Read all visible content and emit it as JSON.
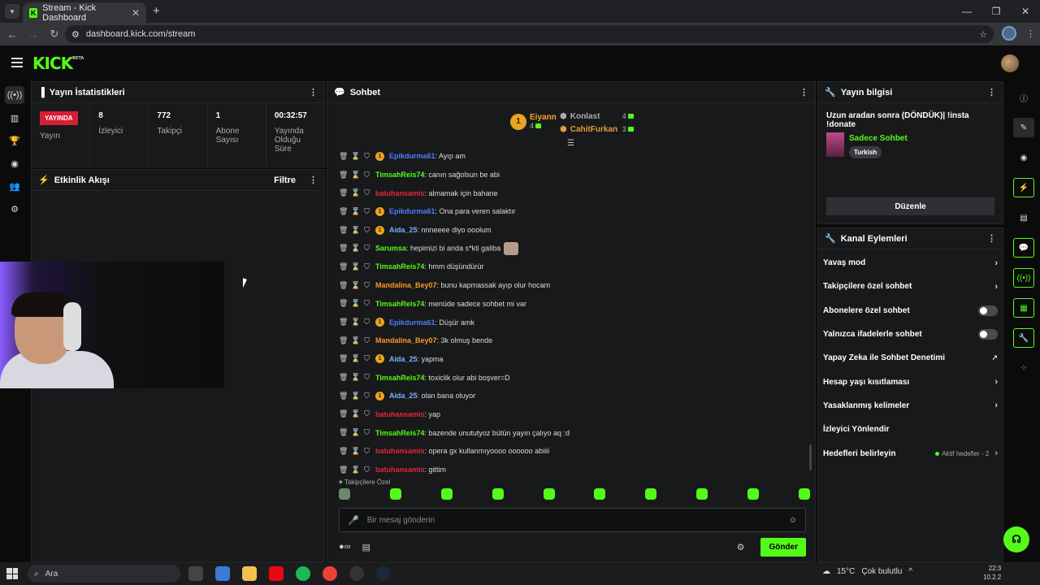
{
  "browser": {
    "tab_title": "Stream - Kick Dashboard",
    "url": "dashboard.kick.com/stream",
    "favicon_letter": "K"
  },
  "kick": {
    "logo": "KICK",
    "beta": "BETA"
  },
  "stats_panel": {
    "title": "Yayın İstatistikleri",
    "live_badge": "YAYINDA",
    "live_label": "Yayın",
    "viewers": {
      "value": "8",
      "label": "İzleyici"
    },
    "followers": {
      "value": "772",
      "label": "Takipçi"
    },
    "subs": {
      "value": "1",
      "label": "Abone Sayısı"
    },
    "uptime": {
      "value": "00:32:57",
      "label": "Yayında Olduğu Süre"
    }
  },
  "activity_panel": {
    "title": "Etkinlik Akışı",
    "filter": "Filtre"
  },
  "chat": {
    "title": "Sohbet",
    "leaderboard": {
      "first": {
        "rank": "1",
        "name": "Eiyann",
        "count": "4"
      },
      "others": [
        {
          "name": "Konlast",
          "count": "4",
          "color": "#aaaaaa"
        },
        {
          "name": "CahitFurkan",
          "count": "3",
          "color": "#e39a3b"
        }
      ]
    },
    "messages": [
      {
        "user": "Epikdurma61",
        "color": "#4a7dff",
        "badge": true,
        "text": ": Ayıp am"
      },
      {
        "user": "TimsahReis74",
        "color": "#53fc18",
        "badge": false,
        "text": ": canın sağolsun be abi"
      },
      {
        "user": "batuhansamis",
        "color": "#e0283c",
        "badge": false,
        "text": ": almamak için bahane"
      },
      {
        "user": "Epikdurma61",
        "color": "#4a7dff",
        "badge": true,
        "text": ": Ona para veren salaktır"
      },
      {
        "user": "Aida_25",
        "color": "#7ab0ff",
        "badge": true,
        "text": ": nnneeee diyo ooolum"
      },
      {
        "user": "Sarumsa",
        "color": "#53fc18",
        "badge": false,
        "text": ": hepimizi bi anda s*kti galiba",
        "emote": true
      },
      {
        "user": "TimsahReis74",
        "color": "#53fc18",
        "badge": false,
        "text": ": hmm düşündürür"
      },
      {
        "user": "Mandalina_Bey07",
        "color": "#f59a23",
        "badge": false,
        "text": ": bunu kapmassak ayıp olur hocam"
      },
      {
        "user": "TimsahReis74",
        "color": "#53fc18",
        "badge": false,
        "text": ": menüde sadece sohbet mi var"
      },
      {
        "user": "Epikdurma61",
        "color": "#4a7dff",
        "badge": true,
        "text": ": Düşür amk"
      },
      {
        "user": "Mandalina_Bey07",
        "color": "#f59a23",
        "badge": false,
        "text": ": 3k olmuş bende"
      },
      {
        "user": "Aida_25",
        "color": "#7ab0ff",
        "badge": true,
        "text": ": yapma"
      },
      {
        "user": "TimsahReis74",
        "color": "#53fc18",
        "badge": false,
        "text": ": toxiclik olur abi boşver=D"
      },
      {
        "user": "Aida_25",
        "color": "#7ab0ff",
        "badge": true,
        "text": ": olan bana oluyor"
      },
      {
        "user": "batuhansamis",
        "color": "#e0283c",
        "badge": false,
        "text": ": yap"
      },
      {
        "user": "TimsahReis74",
        "color": "#53fc18",
        "badge": false,
        "text": ": bazende unututyoz bütün yayın çalıyo aq :d"
      },
      {
        "user": "batuhansamis",
        "color": "#e0283c",
        "badge": false,
        "text": ": opera gx kullanmıyoooo oooooo abiiii"
      },
      {
        "user": "batuhansamis",
        "color": "#e0283c",
        "badge": false,
        "text": ": gittim"
      }
    ],
    "followers_only": "Takipçilere Özel",
    "input_placeholder": "Bir mesaj gönderin",
    "send": "Gönder",
    "badge_symbol": "1"
  },
  "stream_info": {
    "title": "Yayın bilgisi",
    "stream_title": "Uzun aradan sonra (DÖNDÜK)| !insta !donate",
    "category": "Sadece Sohbet",
    "tag": "Turkish",
    "edit": "Düzenle"
  },
  "channel_actions": {
    "title": "Kanal Eylemleri",
    "items": [
      {
        "label": "Yavaş mod",
        "kind": "chevron"
      },
      {
        "label": "Takipçilere özel sohbet",
        "kind": "chevron"
      },
      {
        "label": "Abonelere özel sohbet",
        "kind": "toggle"
      },
      {
        "label": "Yalnızca ifadelerle sohbet",
        "kind": "toggle"
      },
      {
        "label": "Yapay Zeka ile Sohbet Denetimi",
        "kind": "external"
      },
      {
        "label": "Hesap yaşı kısıtlaması",
        "kind": "chevron"
      },
      {
        "label": "Yasaklanmış kelimeler",
        "kind": "chevron"
      },
      {
        "label": "İzleyici Yönlendir",
        "kind": "none"
      },
      {
        "label": "Hedefleri belirleyin",
        "kind": "goal"
      }
    ],
    "goal_text": "Aktif hedefler - 2"
  },
  "taskbar": {
    "search": "Ara",
    "weather": "15°C",
    "weather_desc": "Çok bulutlu",
    "time": "22:3",
    "date": "10.2.2"
  },
  "colors": {
    "accent": "#53fc18",
    "live": "#d61f36",
    "panel": "#18191b"
  }
}
